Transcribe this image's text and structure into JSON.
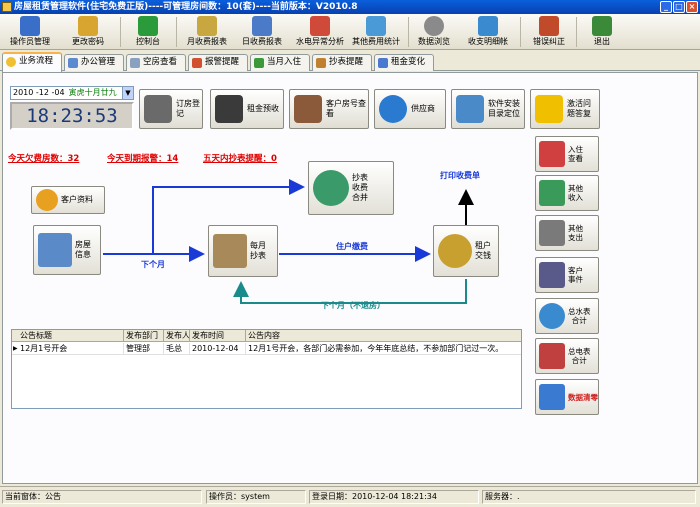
{
  "window": {
    "title": "房屋租赁管理软件(住宅免费正版)----可管理房间数：10(套)----当前版本：V2010.8",
    "buttons": [
      "_",
      "□",
      "×"
    ]
  },
  "toolbar": {
    "items": [
      {
        "label": "操作员管理",
        "icon": "user-admin-icon",
        "color": "#3a6fc9"
      },
      {
        "label": "更改密码",
        "icon": "key-icon",
        "color": "#d8a530"
      },
      {
        "label": "控制台",
        "icon": "console-icon",
        "color": "#2a9a3a"
      },
      {
        "label": "月收费报表",
        "icon": "month-report-icon",
        "color": "#c8a640"
      },
      {
        "label": "日收费报表",
        "icon": "day-report-icon",
        "color": "#4a7ac8"
      },
      {
        "label": "水电异常分析",
        "icon": "water-electric-icon",
        "color": "#d04a3a"
      },
      {
        "label": "其他费用统计",
        "icon": "other-fees-icon",
        "color": "#4a9ad8"
      },
      {
        "label": "数据浏览",
        "icon": "magnifier-icon",
        "color": "#8a8a8a"
      },
      {
        "label": "收支明细帐",
        "icon": "ledger-icon",
        "color": "#3a8ad0"
      },
      {
        "label": "错误纠正",
        "icon": "tools-icon",
        "color": "#c04a2a"
      },
      {
        "label": "退出",
        "icon": "exit-door-icon",
        "color": "#3a8a3a"
      }
    ]
  },
  "tabs": [
    {
      "label": "业务流程",
      "icon": "smile-icon",
      "color": "#f0c030"
    },
    {
      "label": "办公管理",
      "icon": "office-icon",
      "color": "#5a8ad0"
    },
    {
      "label": "空房查看",
      "icon": "page-icon",
      "color": "#8aa0c0"
    },
    {
      "label": "报警提醒",
      "icon": "alarm-icon",
      "color": "#d05030"
    },
    {
      "label": "当月入住",
      "icon": "calendar-icon",
      "color": "#3a9a3a"
    },
    {
      "label": "抄表提醒",
      "icon": "meter-icon",
      "color": "#c08030"
    },
    {
      "label": "租金变化",
      "icon": "rent-icon",
      "color": "#4a7ad0"
    }
  ],
  "date": {
    "value": "2010 -12 -04",
    "lunar": "寅虎十月廿九"
  },
  "clock": "18:23:53",
  "quick_buttons": [
    {
      "label": "订房登记",
      "icon": "booking-icon",
      "color": "#6a6a6a"
    },
    {
      "label": "租金预收",
      "icon": "prepay-icon",
      "color": "#3a3a3a"
    },
    {
      "label": "客户房号查看",
      "icon": "customer-room-icon",
      "color": "#8a5a3a"
    },
    {
      "label": "供应商",
      "icon": "globe-icon",
      "color": "#2a7ad0"
    },
    {
      "label": "软件安装\n目录定位",
      "icon": "folder-icon",
      "color": "#4a8ac8"
    },
    {
      "label": "激活问\n题答复",
      "icon": "warning-icon",
      "color": "#f0c000"
    }
  ],
  "alerts": {
    "owed": "今天欠费房数：32",
    "expiring": "今天到期报警：14",
    "meter": "五天内抄表提醒：0"
  },
  "flow": {
    "customer": "客户资料",
    "house": "房屋\n信息",
    "meter_merge": "抄表\n收费\n合并",
    "monthly": "每月\n抄表",
    "tenant_pay": "租户\n交钱",
    "label_next_month": "下个月",
    "label_payment": "住户缴费",
    "label_print": "打印收费单",
    "label_next_month_stay": "下个月（不退房）"
  },
  "announcements": {
    "columns": [
      "公告标题",
      "发布部门",
      "发布人",
      "发布时间",
      "公告内容"
    ],
    "rows": [
      [
        "12月1号开会",
        "管理部",
        "毛总",
        "2010-12-04",
        "12月1号开会，各部门必需参加，今年年底总结，不参加部门记过一次。"
      ]
    ]
  },
  "side_buttons": [
    {
      "label": "入住\n查看",
      "icon": "checkin-icon",
      "color": "#d04040"
    },
    {
      "label": "其他\n收入",
      "icon": "income-icon",
      "color": "#3a9a5a"
    },
    {
      "label": "其他\n支出",
      "icon": "expense-icon",
      "color": "#7a7a7a"
    },
    {
      "label": "客户\n事件",
      "icon": "event-icon",
      "color": "#5a5a8a"
    },
    {
      "label": "总水表\n合计",
      "icon": "water-meter-icon",
      "color": "#3a8ad0"
    },
    {
      "label": "总电表\n合计",
      "icon": "electric-meter-icon",
      "color": "#c04040"
    },
    {
      "label": "数据清零",
      "icon": "recycle-bin-icon",
      "color": "#3a7ad0"
    }
  ],
  "status": {
    "window_label": "当前窗体：",
    "window_value": "公告",
    "operator_label": "操作员：",
    "operator_value": "system",
    "login_label": "登录日期：",
    "login_value": "2010-12-04 18:21:34",
    "server_label": "服务器：",
    "server_value": "."
  }
}
